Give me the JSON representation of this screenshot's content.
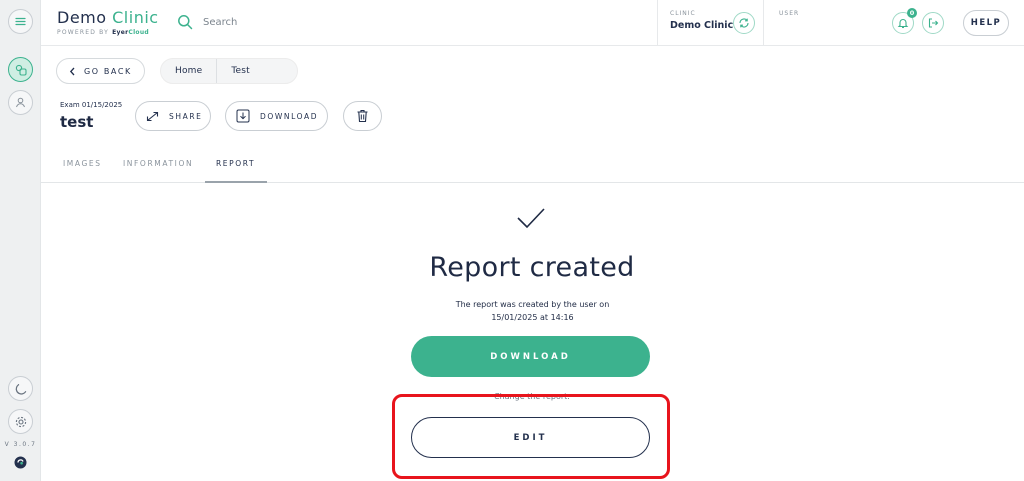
{
  "colors": {
    "accent": "#3cb28e",
    "navy": "#23304d",
    "highlight": "#e8141c",
    "topline": "#2f8fd0"
  },
  "sidebar": {
    "items": [
      {
        "icon": "menu-icon"
      },
      {
        "icon": "patients-icon",
        "active": true
      },
      {
        "icon": "user-icon"
      }
    ],
    "bottom": [
      {
        "icon": "moon-icon"
      },
      {
        "icon": "gear-icon"
      }
    ],
    "version": "V 3.0.7",
    "logo_icon": "eyer-logo-icon"
  },
  "header": {
    "brand_part1": "Demo ",
    "brand_part2": "Clinic",
    "powered_by": "POWERED BY",
    "eyer": "Eyer",
    "cloud": "Cloud",
    "search_label": "Search",
    "clinic_label": "CLINIC",
    "clinic_name": "Demo Clinic",
    "user_label": "USER",
    "notifications_count": "0",
    "help_label": "HELP"
  },
  "toolbar": {
    "go_back": "GO BACK",
    "breadcrumb": [
      "Home",
      "Test"
    ]
  },
  "exam": {
    "date_label": "Exam 01/15/2025",
    "name": "test",
    "share_label": "SHARE",
    "download_label": "DOWNLOAD"
  },
  "tabs": [
    {
      "label": "IMAGES"
    },
    {
      "label": "INFORMATION"
    },
    {
      "label": "REPORT",
      "active": true
    }
  ],
  "report": {
    "title": "Report created",
    "desc_line1": "The report was created by the user on",
    "desc_line2": "15/01/2025 at 14:16",
    "download_label": "DOWNLOAD",
    "change_text": "Change the report:",
    "edit_label": "EDIT"
  }
}
